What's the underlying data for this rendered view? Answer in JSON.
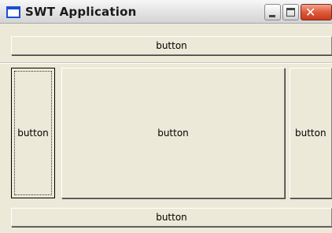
{
  "window": {
    "title": "SWT Application",
    "icon": "window-app-icon",
    "controls": {
      "minimize_icon": "minimize-icon",
      "maximize_icon": "maximize-icon",
      "close_glyph": "✕"
    }
  },
  "buttons": {
    "top_label": "button",
    "left_label": "button",
    "center_label": "button",
    "right_label": "button",
    "bottom_label": "button"
  },
  "colors": {
    "window_background": "#ece9d8",
    "close_button": "#e0593b",
    "title_icon_border": "#1c4fd1"
  }
}
